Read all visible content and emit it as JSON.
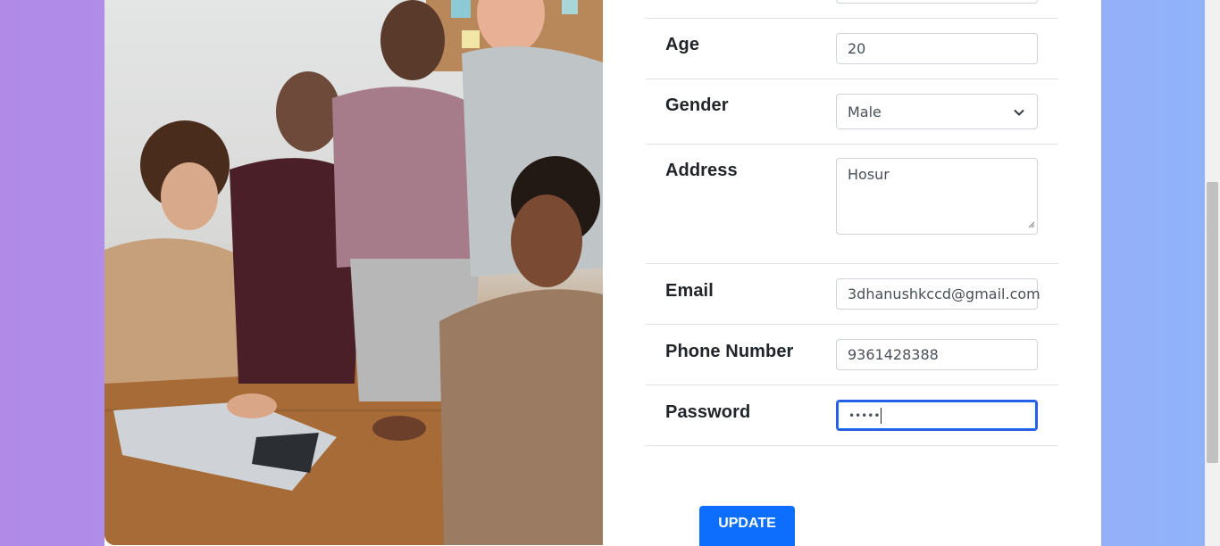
{
  "form": {
    "age": {
      "label": "Age",
      "value": "20"
    },
    "gender": {
      "label": "Gender",
      "value": "Male"
    },
    "address": {
      "label": "Address",
      "value": "Hosur"
    },
    "email": {
      "label": "Email",
      "value": "3dhanushkccd@gmail.com"
    },
    "phone": {
      "label": "Phone Number",
      "value": "9361428388"
    },
    "password": {
      "label": "Password",
      "value": "•••••"
    }
  },
  "update_button": {
    "label": "UPDATE"
  },
  "colors": {
    "accent": "#0d6efd",
    "background_left": "#b18ae8",
    "background_right": "#8fb4fb"
  },
  "icons": [
    "chevron-down-icon",
    "resize-handle-icon"
  ]
}
